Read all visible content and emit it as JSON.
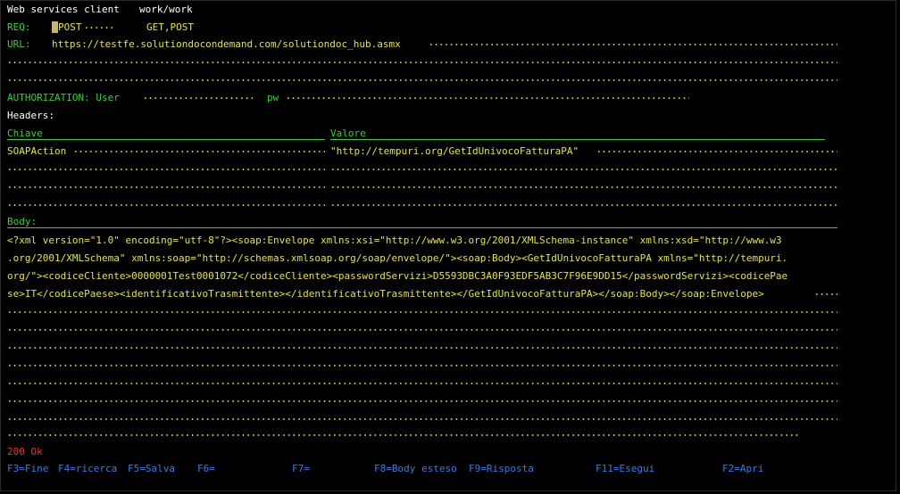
{
  "title": {
    "app": "Web services client",
    "path": "work/work"
  },
  "request": {
    "label": "REQ:",
    "method_value": "POST",
    "method_options": "GET,POST"
  },
  "url": {
    "label": "URL:",
    "value": "https://testfe.solutiondocondemand.com/solutiondoc_hub.asmx"
  },
  "authorization": {
    "label": "AUTHORIZATION: User",
    "pw_label": "pw"
  },
  "headers": {
    "label": "Headers:",
    "col_key": "Chiave",
    "col_value": "Valore",
    "rows": [
      {
        "key": "SOAPAction",
        "value": "\"http://tempuri.org/GetIdUnivocoFatturaPA\""
      }
    ]
  },
  "body": {
    "label": "Body:",
    "lines": [
      "<?xml version=\"1.0\" encoding=\"utf-8\"?><soap:Envelope xmlns:xsi=\"http://www.w3.org/2001/XMLSchema-instance\" xmlns:xsd=\"http://www.w3",
      ".org/2001/XMLSchema\" xmlns:soap=\"http://schemas.xmlsoap.org/soap/envelope/\"><soap:Body><GetIdUnivocoFatturaPA xmlns=\"http://tempuri.",
      "org/\"><codiceCliente>0000001Test0001072</codiceCliente><passwordServizi>D5593DBC3A0F93EDF5AB3C7F96E9DD15</passwordServizi><codicePae",
      "se>IT</codicePaese><identificativoTrasmittente></identificativoTrasmittente></GetIdUnivocoFatturaPA></soap:Body></soap:Envelope>"
    ]
  },
  "status": {
    "text": "200 Ok"
  },
  "fkeys": [
    {
      "label": "F3=Fine"
    },
    {
      "label": "F4=ricerca"
    },
    {
      "label": "F5=Salva"
    },
    {
      "label": "F6="
    },
    {
      "label": "F7="
    },
    {
      "label": "F8=Body esteso"
    },
    {
      "label": "F9=Risposta"
    },
    {
      "label": "F11=Esegui"
    },
    {
      "label": "F2=Apri"
    }
  ],
  "colors": {
    "background": "#000000",
    "label_green": "#31d431",
    "input_yellow": "#e6e632",
    "status_red": "#e43b32",
    "fkey_blue": "#3b7be6",
    "text_white": "#ffffff"
  }
}
